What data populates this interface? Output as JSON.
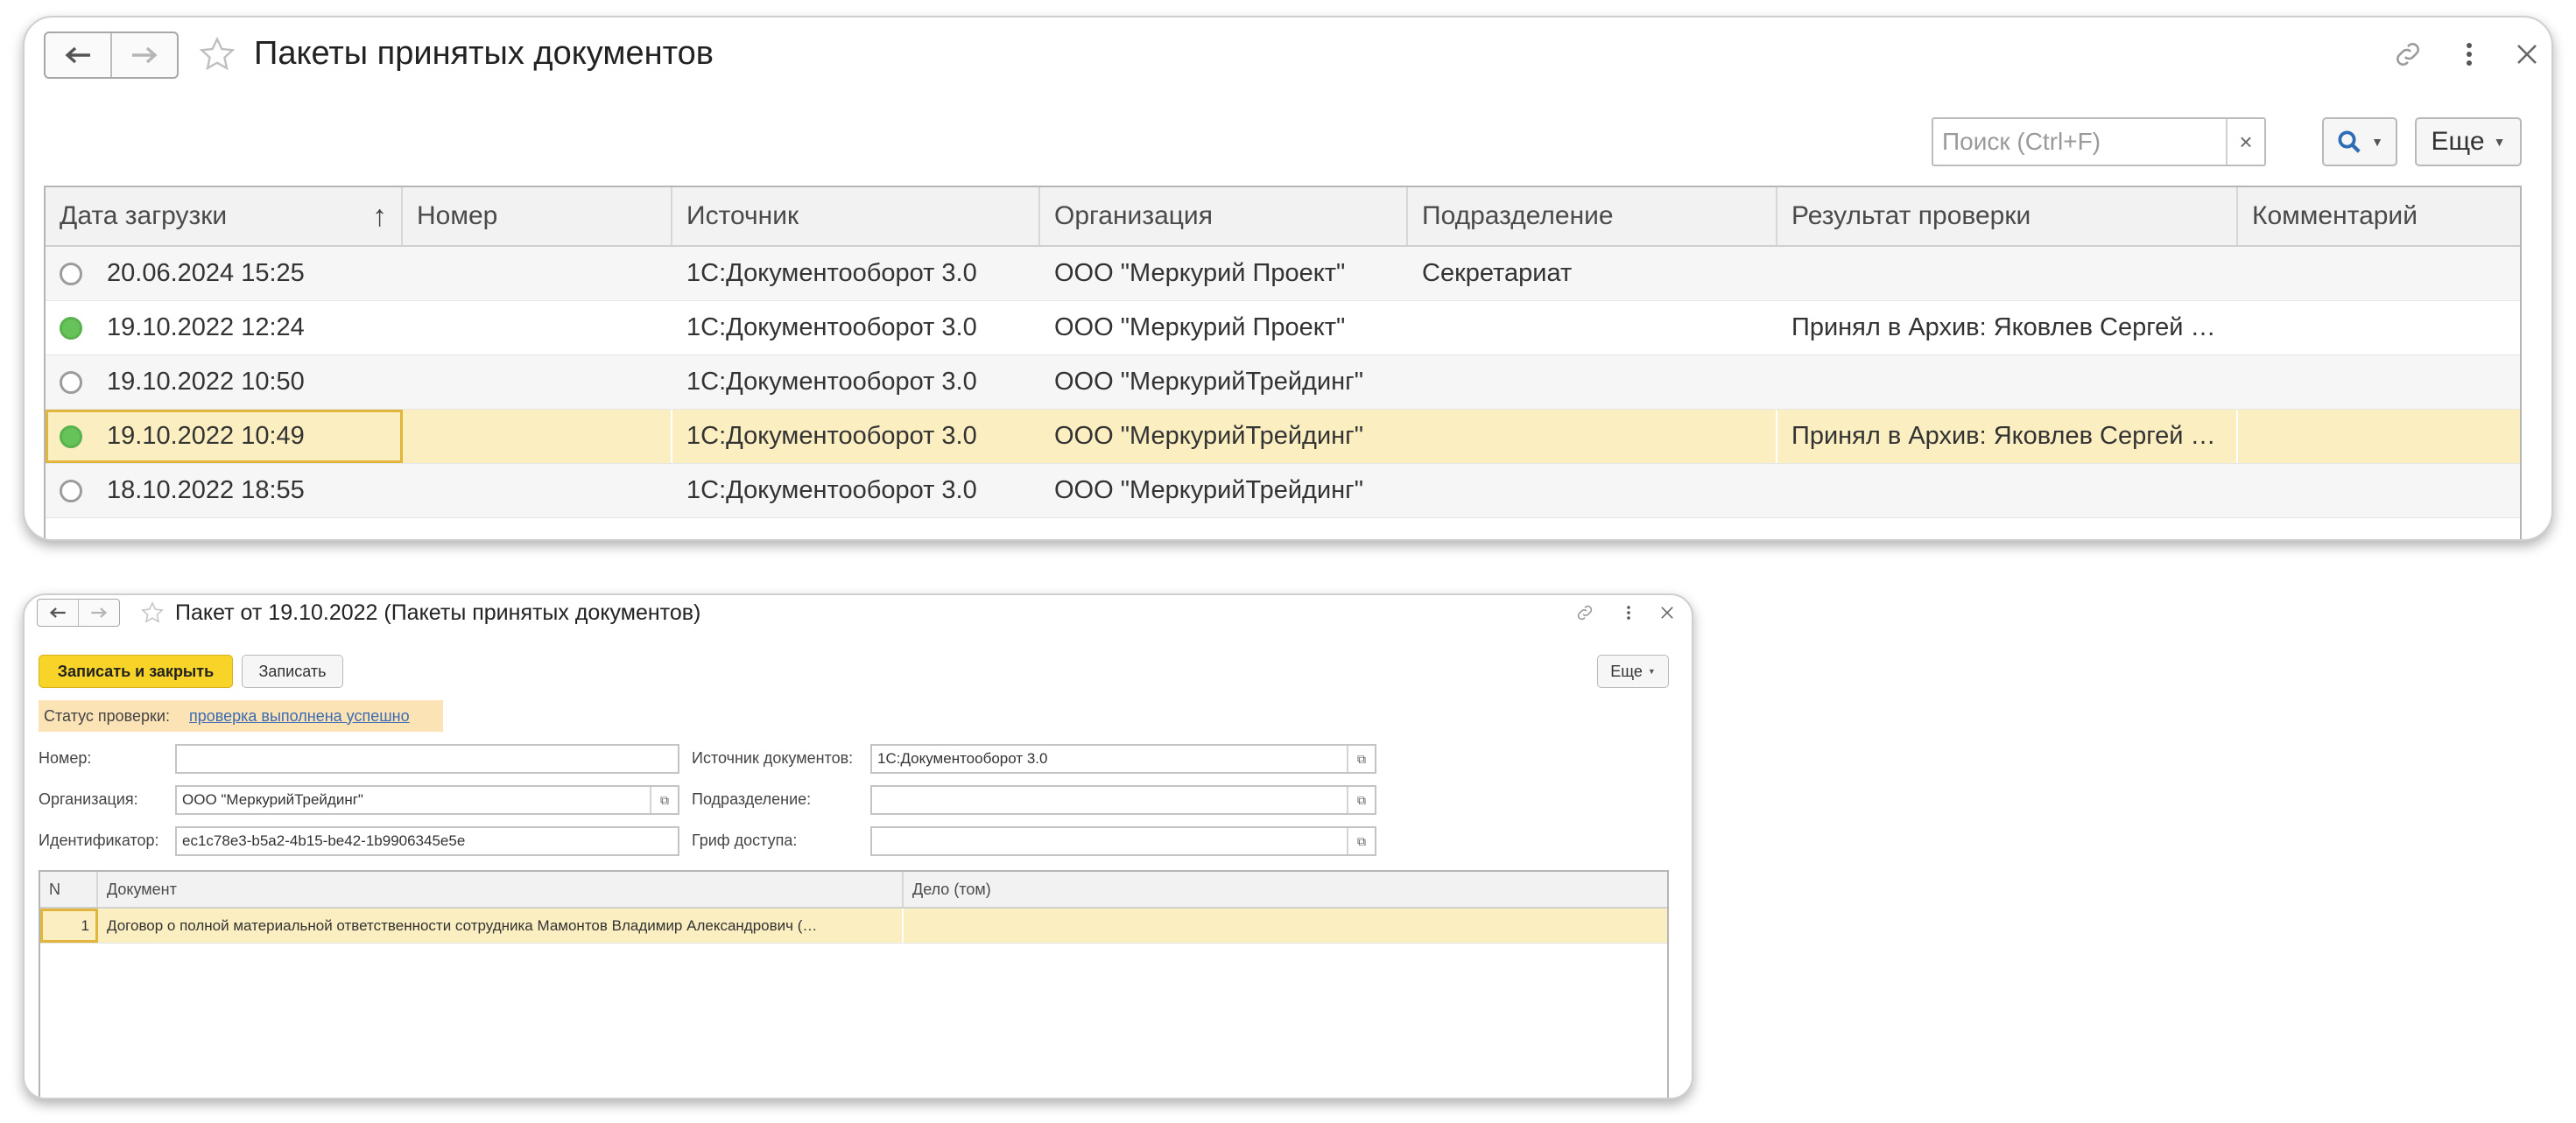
{
  "list_window": {
    "title": "Пакеты принятых документов",
    "search": {
      "placeholder": "Поиск (Ctrl+F)",
      "value": "",
      "clear": "×"
    },
    "more_button": "Еще",
    "columns": [
      "Дата загрузки",
      "Номер",
      "Источник",
      "Организация",
      "Подразделение",
      "Результат проверки",
      "Комментарий"
    ],
    "sort_indicator": "↑",
    "rows": [
      {
        "status": "empty",
        "date": "20.06.2024 15:25",
        "number": "",
        "source": "1С:Документооборот 3.0",
        "org": "ООО \"Меркурий Проект\"",
        "dept": "Секретариат",
        "result": "",
        "comment": ""
      },
      {
        "status": "green",
        "date": "19.10.2022 12:24",
        "number": "",
        "source": "1С:Документооборот 3.0",
        "org": "ООО \"Меркурий Проект\"",
        "dept": "",
        "result": "Принял в Архив: Яковлев Сергей …",
        "comment": ""
      },
      {
        "status": "empty",
        "date": "19.10.2022 10:50",
        "number": "",
        "source": "1С:Документооборот 3.0",
        "org": "ООО \"МеркурийТрейдинг\"",
        "dept": "",
        "result": "",
        "comment": ""
      },
      {
        "status": "green",
        "date": "19.10.2022 10:49",
        "number": "",
        "source": "1С:Документооборот 3.0",
        "org": "ООО \"МеркурийТрейдинг\"",
        "dept": "",
        "result": "Принял в Архив: Яковлев Сергей …",
        "comment": ""
      },
      {
        "status": "empty",
        "date": "18.10.2022 18:55",
        "number": "",
        "source": "1С:Документооборот 3.0",
        "org": "ООО \"МеркурийТрейдинг\"",
        "dept": "",
        "result": "",
        "comment": ""
      }
    ]
  },
  "form_window": {
    "title": "Пакет от 19.10.2022 (Пакеты принятых документов)",
    "save_close": "Записать и закрыть",
    "save": "Записать",
    "more_button": "Еще",
    "status_label": "Статус проверки:",
    "status_value": "проверка выполнена успешно",
    "labels": {
      "number": "Номер:",
      "org": "Организация:",
      "id": "Идентификатор:",
      "source": "Источник документов:",
      "dept": "Подразделение:",
      "access": "Гриф доступа:"
    },
    "values": {
      "number": "",
      "org": "ООО \"МеркурийТрейдинг\"",
      "id": "ec1c78e3-b5a2-4b15-be42-1b9906345e5e",
      "source": "1С:Документооборот 3.0",
      "dept": "",
      "access": ""
    },
    "table": {
      "columns": [
        "N",
        "Документ",
        "Дело (том)"
      ],
      "rows": [
        {
          "n": "1",
          "doc": "Договор о полной материальной ответственности сотрудника Мамонтов Владимир Александрович (…",
          "case": ""
        }
      ]
    }
  }
}
